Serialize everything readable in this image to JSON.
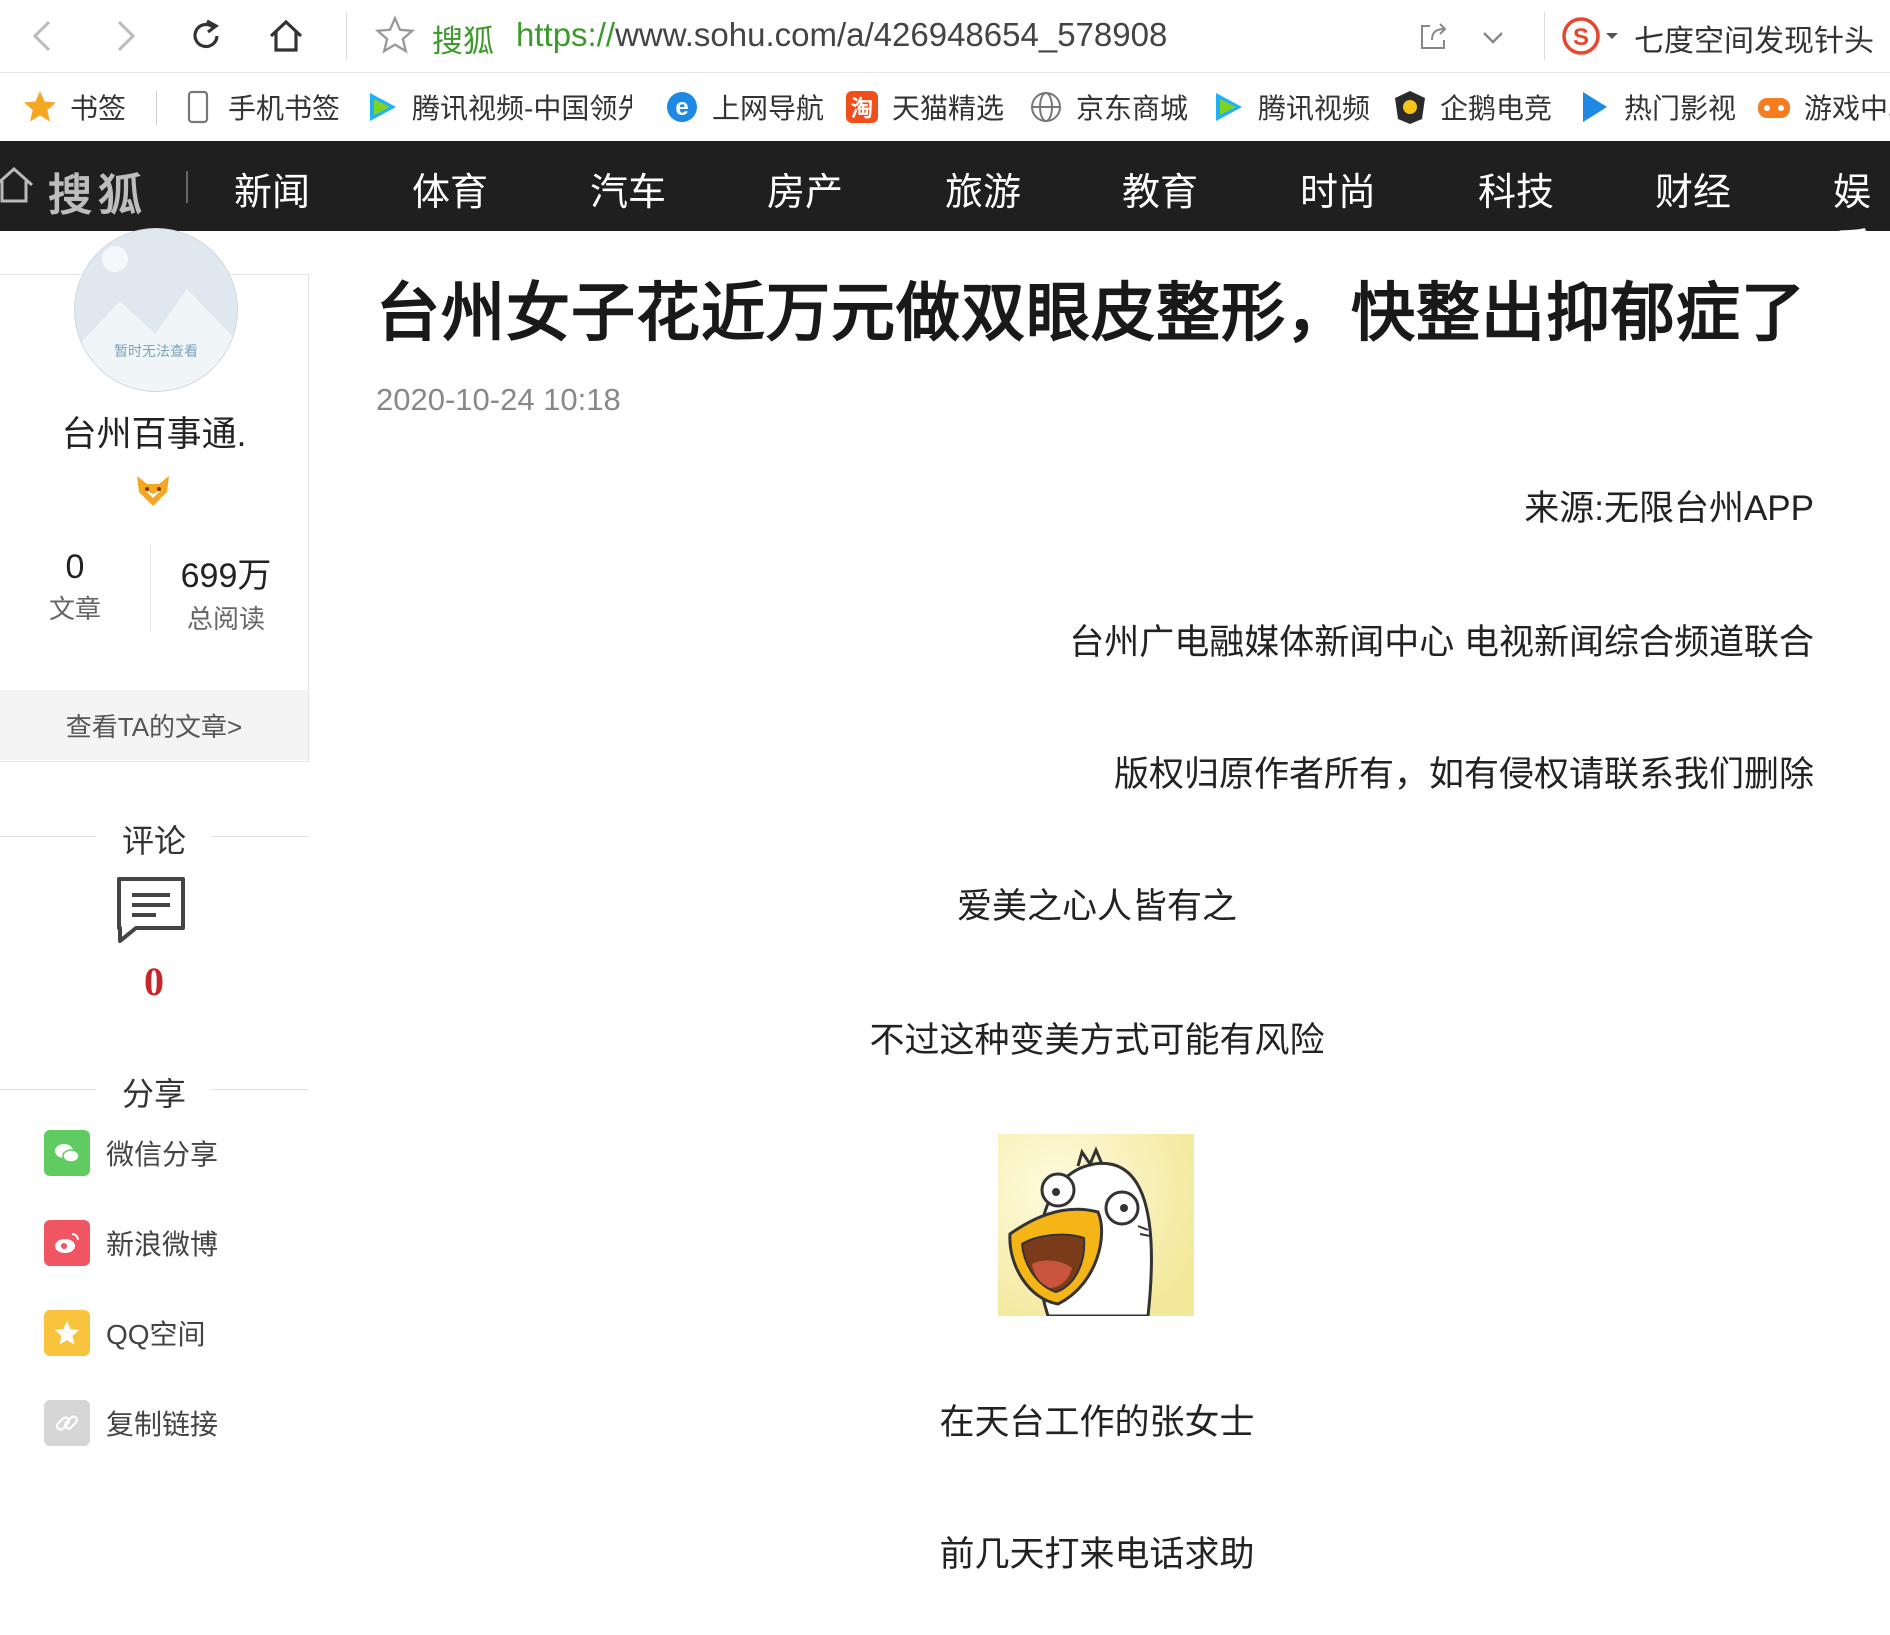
{
  "browser": {
    "site_name": "搜狐",
    "url_protocol": "https://",
    "url_rest": "www.sohu.com/a/426948654_578908",
    "search_hint": "七度空间发现针头"
  },
  "bookmarks": [
    {
      "label": "书签",
      "icon": "star-icon"
    },
    {
      "label": "手机书签",
      "icon": "phone-icon"
    },
    {
      "label": "腾讯视频-中国领先",
      "icon": "tencent-video-icon"
    },
    {
      "label": "上网导航",
      "icon": "ie-icon"
    },
    {
      "label": "天猫精选",
      "icon": "tmall-icon"
    },
    {
      "label": "京东商城",
      "icon": "globe-icon"
    },
    {
      "label": "腾讯视频",
      "icon": "tencent-video-icon"
    },
    {
      "label": "企鹅电竞",
      "icon": "esports-icon"
    },
    {
      "label": "热门影视",
      "icon": "play-icon"
    },
    {
      "label": "游戏中心",
      "icon": "gamepad-icon"
    }
  ],
  "sitenav": {
    "logo": "搜狐",
    "items": [
      "新闻",
      "体育",
      "汽车",
      "房产",
      "旅游",
      "教育",
      "时尚",
      "科技",
      "财经",
      "娱乐"
    ]
  },
  "author": {
    "avatar_text": "暂时无法查看",
    "name": "台州百事通.",
    "articles_count": "0",
    "articles_label": "文章",
    "reads_count": "699万",
    "reads_label": "总阅读",
    "view_articles": "查看TA的文章>"
  },
  "comments": {
    "heading": "评论",
    "count": "0"
  },
  "share": {
    "heading": "分享",
    "items": [
      "微信分享",
      "新浪微博",
      "QQ空间",
      "复制链接"
    ]
  },
  "article": {
    "title": "台州女子花近万元做双眼皮整形，快整出抑郁症了",
    "date": "2020-10-24 10:18",
    "source": "来源:无限台州APP",
    "credit": "台州广电融媒体新闻中心 电视新闻综合频道联合",
    "copyright": "版权归原作者所有，如有侵权请联系我们删除",
    "p1": "爱美之心人皆有之",
    "p2": "不过这种变美方式可能有风险",
    "p3": "在天台工作的张女士",
    "p4": "前几天打来电话求助"
  },
  "colors": {
    "nav_bg": "#1f1f1f",
    "url_green": "#3b9a2a",
    "comment_red": "#c8262b"
  }
}
